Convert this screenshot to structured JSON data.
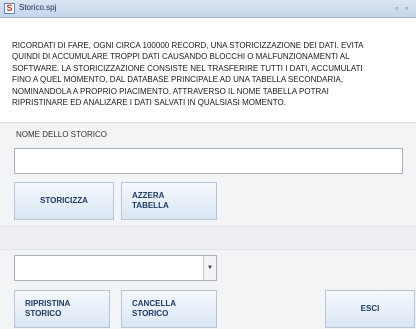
{
  "window": {
    "title": "Storico.spj",
    "icon_letter": "S",
    "minimize_glyph": "▫",
    "maximize_glyph": "▫"
  },
  "info": {
    "lines": [
      "RICORDATI DI FARE, OGNI CIRCA 100000 RECORD, UNA STORICIZZAZIONE DEI DATI. EVITA",
      "QUINDI DI ACCUMULARE TROPPI DATI CAUSANDO BLOCCHI O MALFUNZIONAMENTI AL",
      "SOFTWARE. LA STORICIZZAZIONE CONSISTE NEL TRASFERIRE TUTTI I DATI, ACCUMULATI",
      "FINO A QUEL MOMENTO, DAL DATABASE PRINCIPALE AD UNA TABELLA SECONDARIA,",
      "NOMINANDOLA A PROPRIO PIACIMENTO. ATTRAVERSO IL NOME TABELLA POTRAI",
      "RIPRISTINARE ED ANALIZARE I DATI SALVATI IN QUALSIASI MOMENTO."
    ]
  },
  "form": {
    "name_label": "NOME DELLO STORICO",
    "name_value": "",
    "combo_value": ""
  },
  "buttons": {
    "storicizza": "STORICIZZA",
    "azzera": [
      "AZZERA",
      "TABELLA"
    ],
    "ripristina": [
      "RIPRISTINA",
      "STORICO"
    ],
    "cancella": [
      "CANCELLA",
      "STORICO"
    ],
    "esci": "ESCI"
  },
  "icons": {
    "combo_arrow": "▼"
  },
  "colors": {
    "titlebar": "#c4d5ea",
    "button_text": "#1f3a66",
    "panel_background": "#f3f4f6"
  }
}
